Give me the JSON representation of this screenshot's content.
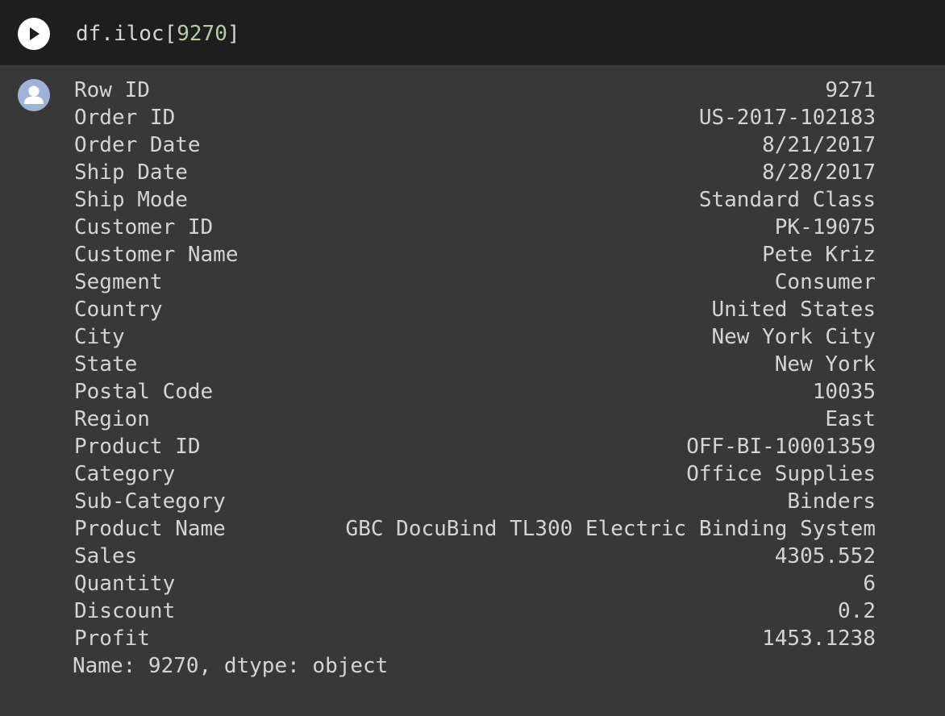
{
  "input": {
    "code_prefix": "df.iloc[",
    "code_index": "9270",
    "code_suffix": "]"
  },
  "output": {
    "rows": [
      {
        "label": "Row ID",
        "value": "9271"
      },
      {
        "label": "Order ID",
        "value": "US-2017-102183"
      },
      {
        "label": "Order Date",
        "value": "8/21/2017"
      },
      {
        "label": "Ship Date",
        "value": "8/28/2017"
      },
      {
        "label": "Ship Mode",
        "value": "Standard Class"
      },
      {
        "label": "Customer ID",
        "value": "PK-19075"
      },
      {
        "label": "Customer Name",
        "value": "Pete Kriz"
      },
      {
        "label": "Segment",
        "value": "Consumer"
      },
      {
        "label": "Country",
        "value": "United States"
      },
      {
        "label": "City",
        "value": "New York City"
      },
      {
        "label": "State",
        "value": "New York"
      },
      {
        "label": "Postal Code",
        "value": "10035"
      },
      {
        "label": "Region",
        "value": "East"
      },
      {
        "label": "Product ID",
        "value": "OFF-BI-10001359"
      },
      {
        "label": "Category",
        "value": "Office Supplies"
      },
      {
        "label": "Sub-Category",
        "value": "Binders"
      },
      {
        "label": "Product Name",
        "value": "GBC DocuBind TL300 Electric Binding System"
      },
      {
        "label": "Sales",
        "value": "4305.552"
      },
      {
        "label": "Quantity",
        "value": "6"
      },
      {
        "label": "Discount",
        "value": "0.2"
      },
      {
        "label": "Profit",
        "value": "1453.1238"
      }
    ],
    "footer": "Name: 9270, dtype: object"
  },
  "icons": {
    "run": "play-icon",
    "output": "user-avatar-icon"
  },
  "colors": {
    "input_background": "#1e1e1e",
    "output_background": "#383838",
    "text": "#d4d4d4",
    "number_literal": "#b5cea8",
    "avatar": "#9fb3d6"
  }
}
